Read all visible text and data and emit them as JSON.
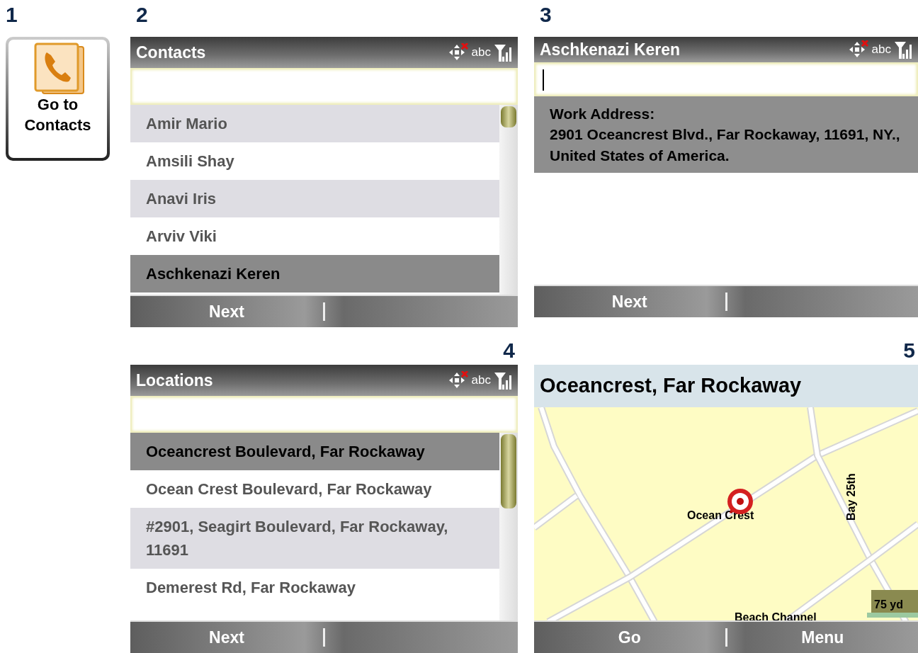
{
  "step_1": {
    "number": "1",
    "button": {
      "label": "Go to Contacts"
    }
  },
  "screens": [
    {
      "kind": "list",
      "number": "2",
      "title": "Contacts",
      "input_mode": "abc",
      "items": [
        {
          "label": "Amir Mario",
          "selected": false
        },
        {
          "label": "Amsili Shay",
          "selected": false
        },
        {
          "label": "Anavi Iris",
          "selected": false
        },
        {
          "label": "Arviv Viki",
          "selected": false
        },
        {
          "label": "Aschkenazi Keren",
          "selected": true
        }
      ],
      "softkeys": [
        "Next"
      ]
    },
    {
      "kind": "detail",
      "number": "3",
      "title": "Aschkenazi Keren",
      "input_mode": "abc",
      "detail_label": "Work Address:",
      "detail_text": "2901 Oceancrest Blvd., Far Rockaway, 11691, NY., United States of America.",
      "softkeys": [
        "Next"
      ]
    },
    {
      "kind": "list",
      "number": "4",
      "title": "Locations",
      "input_mode": "abc",
      "items": [
        {
          "label": "Oceancrest Boulevard, Far Rockaway",
          "selected": true
        },
        {
          "label": "Ocean Crest Boulevard, Far Rockaway",
          "selected": false
        },
        {
          "label": "#2901, Seagirt Boulevard, Far Rockaway, 11691",
          "selected": false
        },
        {
          "label": "Demerest Rd, Far Rockaway",
          "selected": false
        }
      ],
      "softkeys": [
        "Next"
      ]
    },
    {
      "kind": "map",
      "number": "5",
      "title": "Oceancrest, Far Rockaway",
      "map": {
        "labels": [
          "Ocean Crest",
          "Bay 25th",
          "Beach Channel"
        ],
        "scale": "75 yd"
      },
      "softkeys": [
        "Go",
        "Menu"
      ]
    }
  ]
}
